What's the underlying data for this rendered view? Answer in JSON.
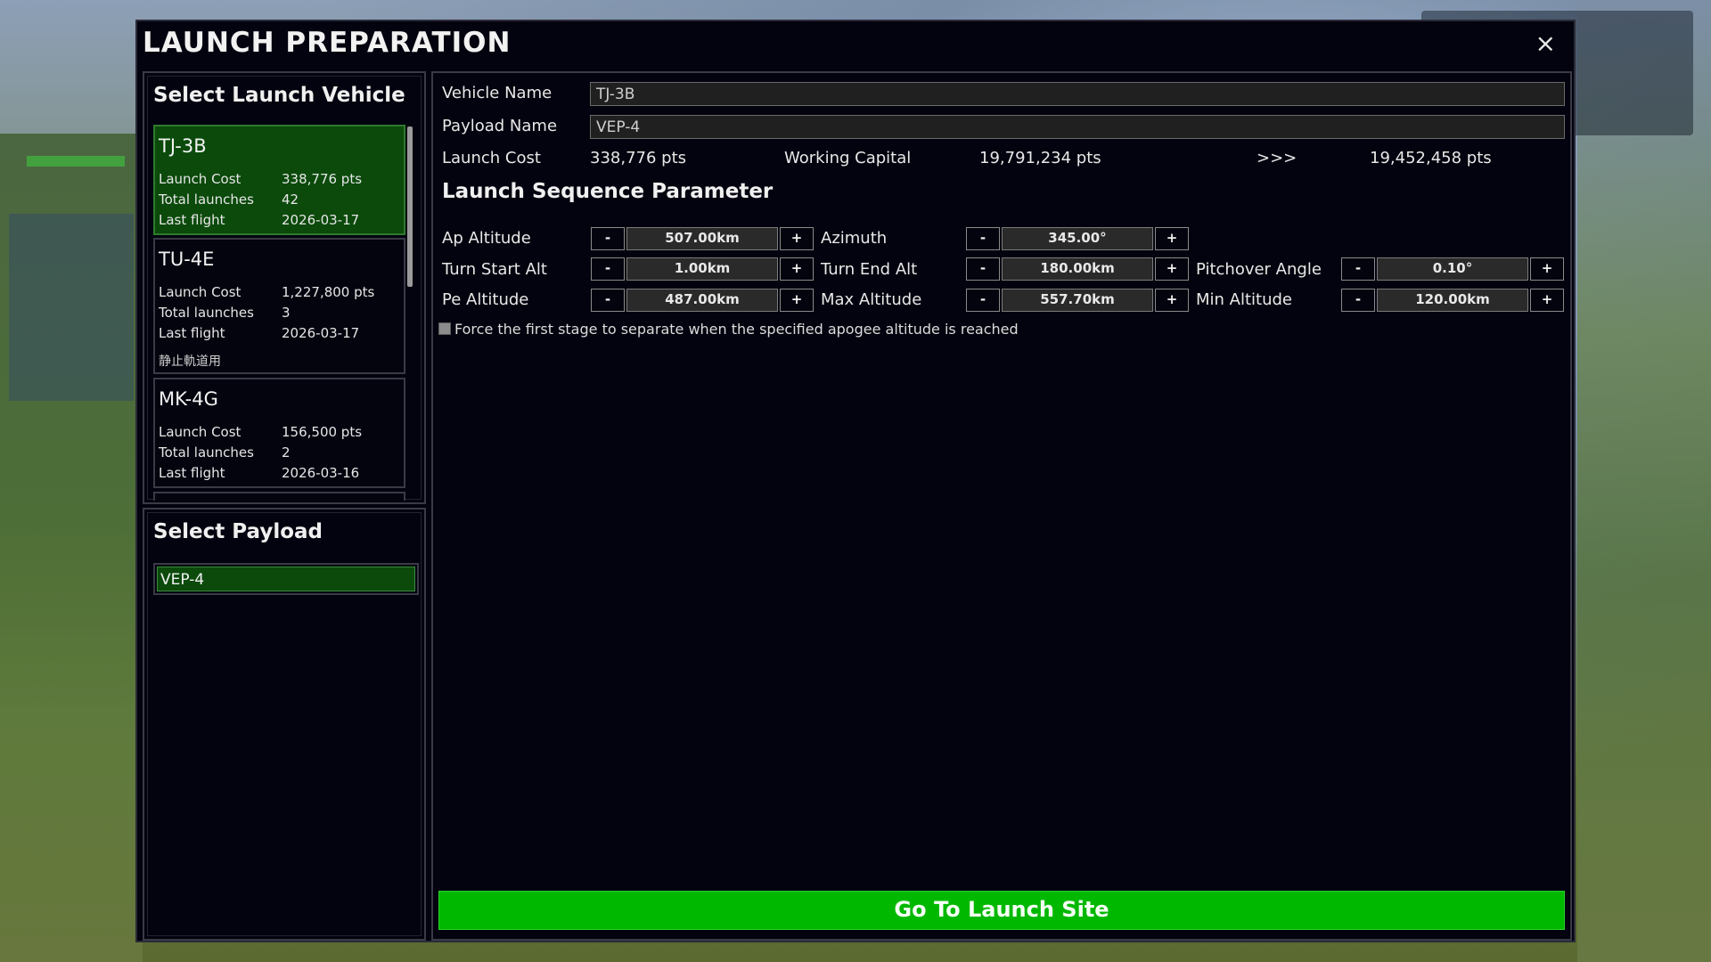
{
  "modal": {
    "title": "LAUNCH PREPARATION",
    "close_label": "×"
  },
  "vehicle_panel": {
    "title": "Select Launch Vehicle",
    "vehicles": [
      {
        "name": "TJ-3B",
        "launch_cost_label": "Launch Cost",
        "launch_cost": "338,776 pts",
        "total_launches_label": "Total launches",
        "total_launches": "42",
        "last_flight_label": "Last flight",
        "last_flight": "2026-03-17",
        "note": "",
        "selected": true
      },
      {
        "name": "TU-4E",
        "launch_cost_label": "Launch Cost",
        "launch_cost": "1,227,800 pts",
        "total_launches_label": "Total launches",
        "total_launches": "3",
        "last_flight_label": "Last flight",
        "last_flight": "2026-03-17",
        "note": "静止軌道用",
        "selected": false
      },
      {
        "name": "MK-4G",
        "launch_cost_label": "Launch Cost",
        "launch_cost": "156,500 pts",
        "total_launches_label": "Total launches",
        "total_launches": "2",
        "last_flight_label": "Last flight",
        "last_flight": "2026-03-16",
        "note": "",
        "selected": false
      }
    ]
  },
  "payload_panel": {
    "title": "Select Payload",
    "items": [
      {
        "name": "VEP-4",
        "selected": true
      }
    ]
  },
  "details": {
    "vehicle_name_label": "Vehicle Name",
    "vehicle_name_value": "TJ-3B",
    "payload_name_label": "Payload Name",
    "payload_name_value": "VEP-4",
    "launch_cost_label": "Launch Cost",
    "launch_cost_value": "338,776 pts",
    "working_capital_label": "Working Capital",
    "working_capital_value": "19,791,234 pts",
    "arrow": ">>>",
    "remaining_value": "19,452,458 pts"
  },
  "sequence": {
    "title": "Launch Sequence Parameter",
    "params": {
      "ap_altitude": {
        "label": "Ap Altitude",
        "value": "507.00km"
      },
      "azimuth": {
        "label": "Azimuth",
        "value": "345.00°"
      },
      "turn_start_alt": {
        "label": "Turn Start Alt",
        "value": "1.00km"
      },
      "turn_end_alt": {
        "label": "Turn End Alt",
        "value": "180.00km"
      },
      "pitchover_angle": {
        "label": "Pitchover Angle",
        "value": "0.10°"
      },
      "pe_altitude": {
        "label": "Pe Altitude",
        "value": "487.00km"
      },
      "max_altitude": {
        "label": "Max Altitude",
        "value": "557.70km"
      },
      "min_altitude": {
        "label": "Min Altitude",
        "value": "120.00km"
      }
    },
    "minus_label": "-",
    "plus_label": "+",
    "force_separation_label": "Force the first stage to separate when the specified apogee altitude is reached",
    "force_separation_checked": false
  },
  "go_button_label": "Go To Launch Site"
}
